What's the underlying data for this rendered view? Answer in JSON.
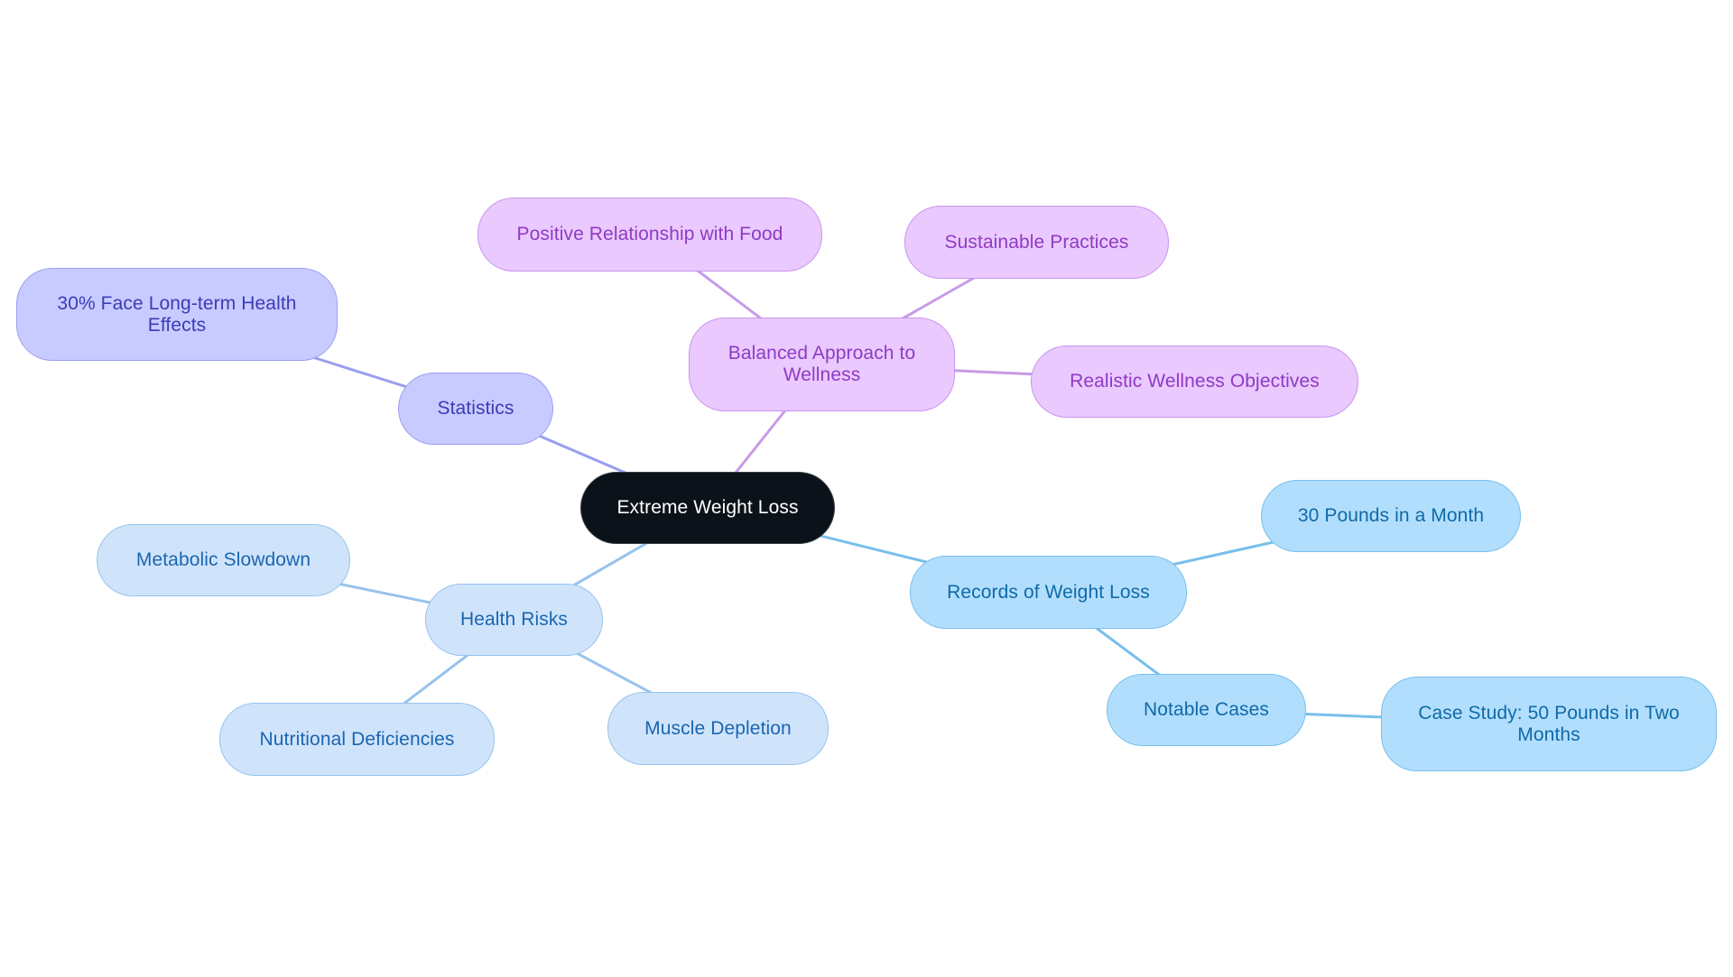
{
  "diagram": {
    "type": "mind-map",
    "root": {
      "id": "n-root",
      "label": "Extreme Weight Loss"
    },
    "colors": {
      "root": "#0c1219",
      "statistics": "#c8cbff",
      "balanced_approach": "#e9c9fe",
      "records": "#b2defd",
      "health_risks": "#cfe4fb",
      "edge_statistics": "#9a9ef0",
      "edge_balanced": "#c79be8",
      "edge_records": "#78bfeb",
      "edge_health": "#98c2ec"
    },
    "nodes": {
      "n-root": "Extreme Weight Loss",
      "n-stats": "Statistics",
      "n-30pct": "30% Face Long-term Health Effects",
      "n-bal": "Balanced Approach to Wellness",
      "n-pos": "Positive Relationship with Food",
      "n-sus": "Sustainable Practices",
      "n-real": "Realistic Wellness Objectives",
      "n-rec": "Records of Weight Loss",
      "n-30lb": "30 Pounds in a Month",
      "n-notab": "Notable Cases",
      "n-case": "Case Study: 50 Pounds in Two Months",
      "n-health": "Health Risks",
      "n-meta": "Metabolic Slowdown",
      "n-nutr": "Nutritional Deficiencies",
      "n-musc": "Muscle Depletion"
    },
    "edges": [
      {
        "from": "n-root",
        "to": "n-stats",
        "branch": "edge_statistics"
      },
      {
        "from": "n-stats",
        "to": "n-30pct",
        "branch": "edge_statistics"
      },
      {
        "from": "n-root",
        "to": "n-bal",
        "branch": "edge_balanced"
      },
      {
        "from": "n-bal",
        "to": "n-pos",
        "branch": "edge_balanced"
      },
      {
        "from": "n-bal",
        "to": "n-sus",
        "branch": "edge_balanced"
      },
      {
        "from": "n-bal",
        "to": "n-real",
        "branch": "edge_balanced"
      },
      {
        "from": "n-root",
        "to": "n-rec",
        "branch": "edge_records"
      },
      {
        "from": "n-rec",
        "to": "n-30lb",
        "branch": "edge_records"
      },
      {
        "from": "n-rec",
        "to": "n-notab",
        "branch": "edge_records"
      },
      {
        "from": "n-notab",
        "to": "n-case",
        "branch": "edge_records"
      },
      {
        "from": "n-root",
        "to": "n-health",
        "branch": "edge_health"
      },
      {
        "from": "n-health",
        "to": "n-meta",
        "branch": "edge_health"
      },
      {
        "from": "n-health",
        "to": "n-nutr",
        "branch": "edge_health"
      },
      {
        "from": "n-health",
        "to": "n-musc",
        "branch": "edge_health"
      }
    ]
  }
}
